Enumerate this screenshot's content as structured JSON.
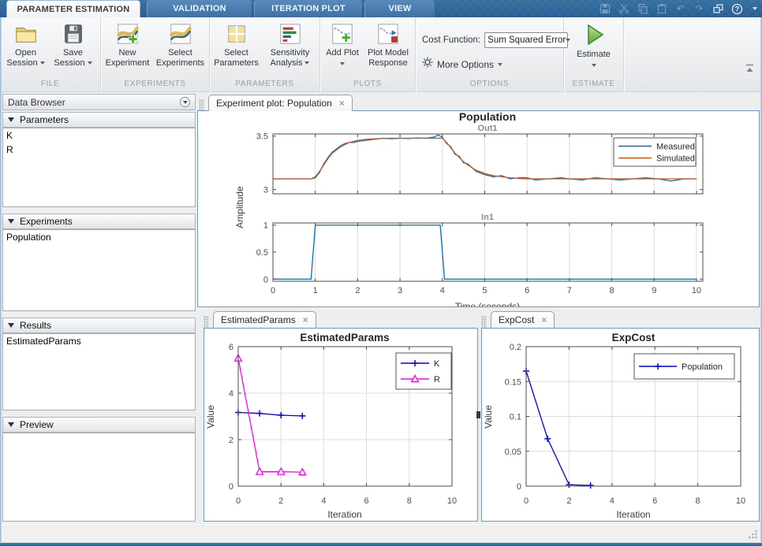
{
  "window": {
    "tabs": [
      {
        "label": "PARAMETER ESTIMATION",
        "active": true
      },
      {
        "label": "VALIDATION",
        "active": false
      },
      {
        "label": "ITERATION PLOT",
        "active": false
      },
      {
        "label": "VIEW",
        "active": false
      }
    ],
    "quick_access_icons": [
      "save",
      "cut",
      "copy",
      "paste",
      "undo",
      "redo",
      "windows",
      "help",
      "menu-caret"
    ]
  },
  "ribbon": {
    "groups": [
      {
        "label": "FILE"
      },
      {
        "label": "EXPERIMENTS"
      },
      {
        "label": "PARAMETERS"
      },
      {
        "label": "PLOTS"
      },
      {
        "label": "OPTIONS"
      },
      {
        "label": "ESTIMATE"
      }
    ],
    "buttons": {
      "open_session": {
        "line1": "Open",
        "line2": "Session"
      },
      "save_session": {
        "line1": "Save",
        "line2": "Session"
      },
      "new_experiment": {
        "line1": "New",
        "line2": "Experiment"
      },
      "select_experiments": {
        "line1": "Select",
        "line2": "Experiments"
      },
      "select_parameters": {
        "line1": "Select",
        "line2": "Parameters"
      },
      "sensitivity_analysis": {
        "line1": "Sensitivity",
        "line2": "Analysis"
      },
      "add_plot": {
        "line1": "Add Plot"
      },
      "plot_model_response": {
        "line1": "Plot Model",
        "line2": "Response"
      },
      "estimate": {
        "label": "Estimate"
      }
    },
    "cost_function": {
      "label": "Cost Function:",
      "value": "Sum Squared Error"
    },
    "more_options": {
      "label": "More Options"
    }
  },
  "data_browser": {
    "title": "Data Browser",
    "sections": [
      {
        "label": "Parameters",
        "items": [
          "K",
          "R"
        ]
      },
      {
        "label": "Experiments",
        "items": [
          "Population"
        ]
      },
      {
        "label": "Results",
        "items": [
          "EstimatedParams"
        ]
      },
      {
        "label": "Preview",
        "items": []
      }
    ]
  },
  "panels": {
    "experiment_tab": "Experiment plot: Population",
    "estimated_tab": "EstimatedParams",
    "expcost_tab": "ExpCost"
  },
  "colors": {
    "measured": "#0072BD",
    "simulated": "#D95319",
    "series_blue": "#0000EE",
    "series_magenta": "#FF00FF",
    "ribbon_blue": "#2e68a2"
  },
  "chart_data": [
    {
      "id": "population_out1",
      "type": "line",
      "title": "Population",
      "subtitle": "Out1",
      "ylabel": "Amplitude",
      "xlim": [
        0,
        10.15
      ],
      "ylim": [
        2.96,
        3.52
      ],
      "xticks": [
        0,
        1,
        2,
        3,
        4,
        5,
        6,
        7,
        8,
        9,
        10
      ],
      "show_xticklabels": false,
      "yticks": [
        3,
        3.5
      ],
      "xgrid": [
        1,
        2,
        3,
        4,
        5,
        6,
        7,
        8,
        9,
        10
      ],
      "legend": {
        "position": "northeast",
        "entries": [
          "Measured",
          "Simulated"
        ]
      },
      "series": [
        {
          "name": "Measured",
          "color": "#0072BD",
          "marker": "none",
          "x": [
            0,
            0.2,
            0.4,
            0.6,
            0.8,
            0.9,
            1,
            1.1,
            1.2,
            1.3,
            1.4,
            1.5,
            1.6,
            1.7,
            1.8,
            1.9,
            2,
            2.2,
            2.4,
            2.6,
            2.8,
            3,
            3.2,
            3.4,
            3.6,
            3.7,
            3.8,
            3.9,
            4,
            4.1,
            4.2,
            4.3,
            4.4,
            4.5,
            4.6,
            4.8,
            5,
            5.2,
            5.4,
            5.6,
            5.8,
            6,
            6.2,
            6.5,
            6.8,
            7,
            7.3,
            7.6,
            7.9,
            8.2,
            8.5,
            8.8,
            9.1,
            9.4,
            9.7,
            10
          ],
          "y": [
            3.1,
            3.1,
            3.1,
            3.1,
            3.1,
            3.1,
            3.11,
            3.16,
            3.24,
            3.3,
            3.35,
            3.38,
            3.41,
            3.43,
            3.44,
            3.44,
            3.45,
            3.46,
            3.47,
            3.48,
            3.475,
            3.48,
            3.477,
            3.483,
            3.48,
            3.485,
            3.49,
            3.51,
            3.49,
            3.43,
            3.4,
            3.33,
            3.31,
            3.25,
            3.24,
            3.17,
            3.14,
            3.12,
            3.13,
            3.1,
            3.11,
            3.11,
            3.09,
            3.1,
            3.11,
            3.1,
            3.09,
            3.11,
            3.1,
            3.09,
            3.1,
            3.11,
            3.1,
            3.08,
            3.1,
            3.1
          ]
        },
        {
          "name": "Simulated",
          "color": "#D95319",
          "marker": "none",
          "x": [
            0,
            0.2,
            0.4,
            0.6,
            0.8,
            0.9,
            1,
            1.1,
            1.2,
            1.3,
            1.4,
            1.5,
            1.6,
            1.7,
            1.8,
            1.9,
            2,
            2.2,
            2.4,
            2.6,
            2.8,
            3,
            3.2,
            3.4,
            3.6,
            3.7,
            3.8,
            3.9,
            4,
            4.1,
            4.2,
            4.3,
            4.4,
            4.5,
            4.6,
            4.8,
            5,
            5.2,
            5.4,
            5.6,
            5.8,
            6,
            6.2,
            6.5,
            6.8,
            7,
            7.3,
            7.6,
            7.9,
            8.2,
            8.5,
            8.8,
            9.1,
            9.4,
            9.7,
            10
          ],
          "y": [
            3.1,
            3.1,
            3.1,
            3.1,
            3.1,
            3.1,
            3.12,
            3.17,
            3.23,
            3.29,
            3.34,
            3.37,
            3.4,
            3.42,
            3.44,
            3.45,
            3.46,
            3.47,
            3.475,
            3.478,
            3.48,
            3.48,
            3.48,
            3.48,
            3.48,
            3.48,
            3.48,
            3.48,
            3.48,
            3.44,
            3.39,
            3.34,
            3.3,
            3.26,
            3.23,
            3.18,
            3.15,
            3.13,
            3.12,
            3.11,
            3.105,
            3.1,
            3.1,
            3.1,
            3.1,
            3.1,
            3.1,
            3.1,
            3.1,
            3.1,
            3.1,
            3.1,
            3.1,
            3.1,
            3.1,
            3.1
          ]
        }
      ]
    },
    {
      "id": "population_in1",
      "type": "line",
      "subtitle": "In1",
      "xlabel": "Time (seconds)",
      "xlim": [
        0,
        10.15
      ],
      "ylim": [
        -0.04,
        1.04
      ],
      "xticks": [
        0,
        1,
        2,
        3,
        4,
        5,
        6,
        7,
        8,
        9,
        10
      ],
      "show_xticklabels": true,
      "yticks": [
        0,
        0.5,
        1
      ],
      "xgrid": [
        1,
        2,
        3,
        4,
        5,
        6,
        7,
        8,
        9,
        10
      ],
      "series": [
        {
          "name": "In1",
          "color": "#0072BD",
          "marker": "none",
          "x": [
            0,
            0.9,
            1,
            3.95,
            4.05,
            10
          ],
          "y": [
            0,
            0,
            1,
            1,
            0,
            0
          ]
        }
      ]
    },
    {
      "id": "estimated_params",
      "type": "line",
      "title": "EstimatedParams",
      "xlabel": "Iteration",
      "ylabel": "Value",
      "xlim": [
        0,
        10
      ],
      "ylim": [
        0,
        6
      ],
      "xticks": [
        0,
        2,
        4,
        6,
        8,
        10
      ],
      "show_xticklabels": true,
      "yticks": [
        0,
        2,
        4,
        6
      ],
      "xgrid": [
        2,
        4,
        6,
        8
      ],
      "ygrid": [
        2,
        4
      ],
      "legend": {
        "position": "northeast",
        "entries": [
          "K",
          "R"
        ]
      },
      "series": [
        {
          "name": "K",
          "color": "#0000EE",
          "marker": "plus",
          "x": [
            0,
            1,
            2,
            3
          ],
          "y": [
            3.17,
            3.13,
            3.05,
            3.02
          ]
        },
        {
          "name": "R",
          "color": "#FF00FF",
          "marker": "triangle",
          "x": [
            0,
            1,
            2,
            3
          ],
          "y": [
            5.5,
            0.62,
            0.62,
            0.6
          ]
        }
      ]
    },
    {
      "id": "exp_cost",
      "type": "line",
      "title": "ExpCost",
      "xlabel": "Iteration",
      "ylabel": "Value",
      "xlim": [
        0,
        10
      ],
      "ylim": [
        0,
        0.2
      ],
      "xticks": [
        0,
        2,
        4,
        6,
        8,
        10
      ],
      "show_xticklabels": true,
      "yticks": [
        0,
        0.05,
        0.1,
        0.15,
        0.2
      ],
      "xgrid": [
        2,
        4,
        6,
        8
      ],
      "ygrid": [
        0.05,
        0.1,
        0.15
      ],
      "legend": {
        "position": "northeast",
        "entries": [
          "Population"
        ]
      },
      "series": [
        {
          "name": "Population",
          "color": "#0000EE",
          "marker": "plus",
          "x": [
            0,
            1,
            2,
            3
          ],
          "y": [
            0.165,
            0.068,
            0.002,
            0.001
          ]
        }
      ]
    }
  ]
}
